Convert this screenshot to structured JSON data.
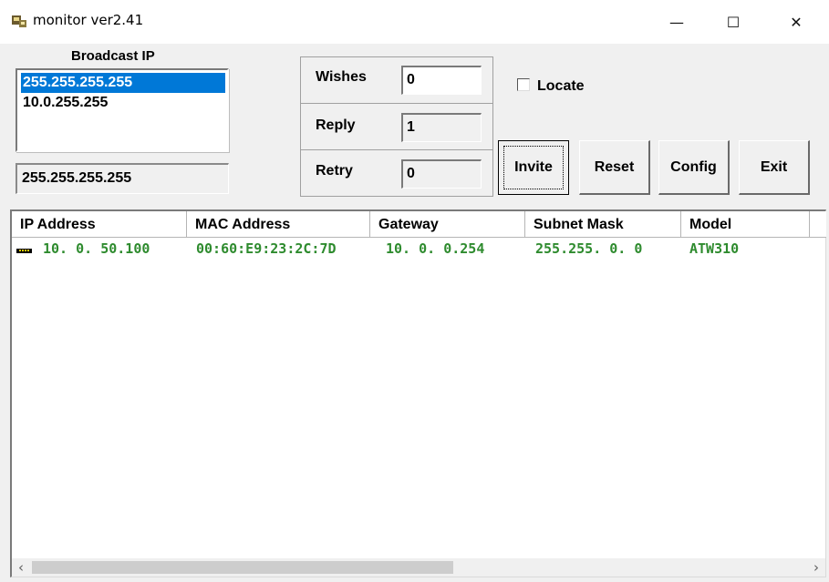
{
  "window": {
    "title": "monitor ver2.41",
    "controls": {
      "minimize": "—",
      "maximize": "☐",
      "close": "✕"
    }
  },
  "broadcast": {
    "label": "Broadcast IP",
    "items": [
      "255.255.255.255",
      "10.0.255.255"
    ],
    "selected_index": 0,
    "current_value": "255.255.255.255"
  },
  "stats": {
    "wishes_label": "Wishes",
    "wishes_value": "0",
    "reply_label": "Reply",
    "reply_value": "1",
    "retry_label": "Retry",
    "retry_value": "0"
  },
  "locate": {
    "label": "Locate",
    "checked": false
  },
  "buttons": {
    "invite": "Invite",
    "reset": "Reset",
    "config": "Config",
    "exit": "Exit"
  },
  "device_list": {
    "columns": [
      "IP Address",
      "MAC Address",
      "Gateway",
      "Subnet Mask",
      "Model"
    ],
    "rows": [
      {
        "ip": "10. 0. 50.100",
        "mac": "00:60:E9:23:2C:7D",
        "gateway": "10. 0. 0.254",
        "subnet": "255.255. 0. 0",
        "model": "ATW310"
      }
    ],
    "row_text_color": "#2e8b2e"
  },
  "scrollbar": {
    "left_arrow": "‹",
    "right_arrow": "›"
  }
}
